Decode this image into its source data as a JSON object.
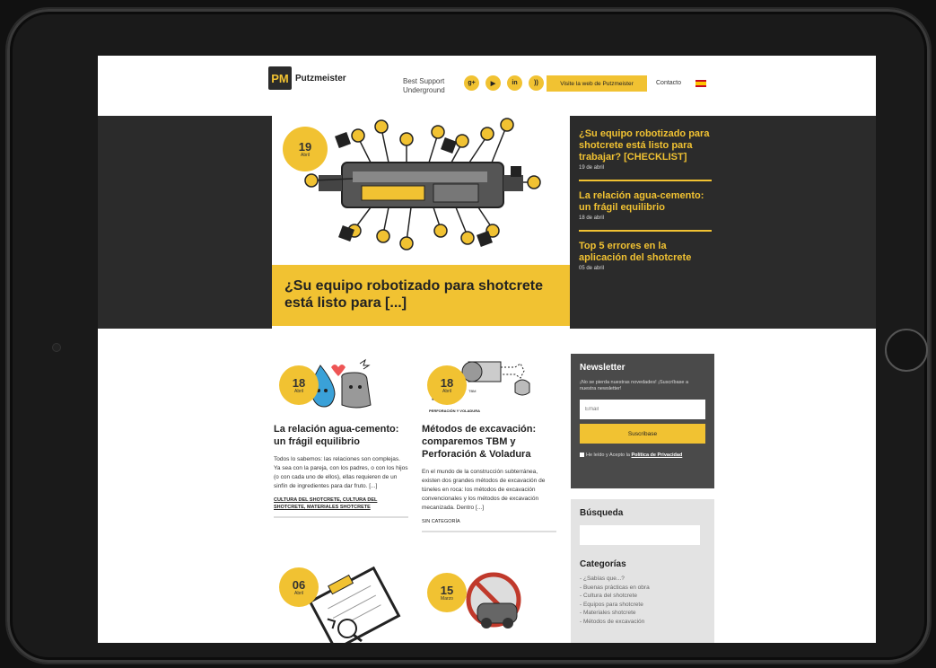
{
  "header": {
    "brand": "Putzmeister",
    "logo_glyph": "PM",
    "tagline_1": "Best Support",
    "tagline_2": "Underground",
    "social": [
      {
        "icon": "google-plus-icon",
        "glyph": "g+"
      },
      {
        "icon": "youtube-icon",
        "glyph": "▶"
      },
      {
        "icon": "linkedin-icon",
        "glyph": "in"
      },
      {
        "icon": "rss-icon",
        "glyph": "))"
      }
    ],
    "visit_label": "Visite la web de Putzmeister",
    "contact_label": "Contacto",
    "language_flag": "spain-flag-icon"
  },
  "hero": {
    "day": "19",
    "month": "Abril",
    "caption": "¿Su equipo robotizado para shotcrete está listo para [...]",
    "side": [
      {
        "title": "¿Su equipo robotizado para shotcrete está listo para trabajar? [CHECKLIST]",
        "date": "19 de abril"
      },
      {
        "title": "La relación agua-cemento: un frágil equilibrio",
        "date": "18 de abril"
      },
      {
        "title": "Top 5 errores en la aplicación del shotcrete",
        "date": "05 de abril"
      }
    ]
  },
  "posts": [
    {
      "day": "18",
      "month": "Abril",
      "title": "La relación agua-cemento: un frágil equilibrio",
      "excerpt": "Todos lo sabemos: las relaciones son complejas. Ya sea con la pareja, con los padres, o con los hijos (o con cada uno de ellos), ellas requieren de un sinfín de ingredientes para dar fruto.  [...]",
      "tags": "CULTURA DEL SHOTCRETE, CULTURA DEL SHOTCRETE, MATERIALES SHOTCRETE"
    },
    {
      "day": "18",
      "month": "Abril",
      "title": "Métodos de excavación: comparemos TBM y Perforación & Voladura",
      "excerpt": "En el mundo de la construcción subterránea, existen dos grandes métodos de excavación de túneles en roca: los métodos de excavación convencionales y los métodos de excavación mecanizada. Dentro [...]",
      "tags": "SIN CATEGORÍA",
      "illus_label_1": "TBM",
      "illus_label_2": "PERFORACIÓN Y VOLADURA"
    },
    {
      "day": "06",
      "month": "Abril"
    },
    {
      "day": "15",
      "month": "Marzo"
    }
  ],
  "newsletter": {
    "title": "Newsletter",
    "text": "¡No se pierda nuestras novedades! ¡Suscríbase a nuestra newsletter!",
    "email_placeholder": "Email",
    "subscribe_label": "Suscribase",
    "accept_prefix": "He leído y Acepto la",
    "accept_link": "Política de Privacidad"
  },
  "search": {
    "title": "Búsqueda"
  },
  "categories": {
    "title": "Categorías",
    "items": [
      "- ¿Sabías que...?",
      "- Buenas prácticas en obra",
      "- Cultura del shotcrete",
      "- Equipos para shotcrete",
      "- Materiales shotcrete",
      "- Métodos de excavación"
    ]
  },
  "colors": {
    "accent": "#f1c232",
    "dark": "#2b2b2b"
  }
}
